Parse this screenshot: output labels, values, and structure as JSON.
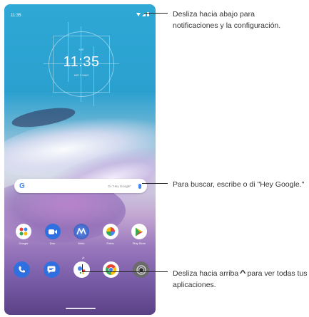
{
  "status_bar": {
    "time": "11:35"
  },
  "clock_widget": {
    "day": "MIÉ",
    "time": "11:35",
    "date": "MIÉ 3 MAR"
  },
  "search": {
    "logo": "G",
    "placeholder": "Di \"Hey Google\""
  },
  "apps": [
    {
      "label": "Google",
      "icon": "google-folder-icon",
      "color": "#ffffff"
    },
    {
      "label": "Duo",
      "icon": "duo-icon",
      "color": "#2f6fe0"
    },
    {
      "label": "Moto",
      "icon": "moto-icon",
      "color": "#4b6bd6"
    },
    {
      "label": "Fotos",
      "icon": "photos-icon",
      "color": "#ffffff"
    },
    {
      "label": "Play Store",
      "icon": "play-store-icon",
      "color": "#ffffff"
    }
  ],
  "dock": [
    {
      "icon": "phone-icon",
      "color": "#2f6fe0"
    },
    {
      "icon": "messages-icon",
      "color": "#2f6fe0"
    },
    {
      "icon": "assistant-icon",
      "color": "#ffffff"
    },
    {
      "icon": "chrome-icon",
      "color": "#ffffff"
    },
    {
      "icon": "camera-icon",
      "color": "#6b6b6b"
    }
  ],
  "callouts": {
    "notifications": "Desliza hacia abajo para notificaciones y la configuración.",
    "search": "Para buscar, escribe o di \"Hey Google.\"",
    "swipe_up_before": "Desliza hacia arriba",
    "swipe_up_after": "para ver todas tus aplicaciones."
  }
}
